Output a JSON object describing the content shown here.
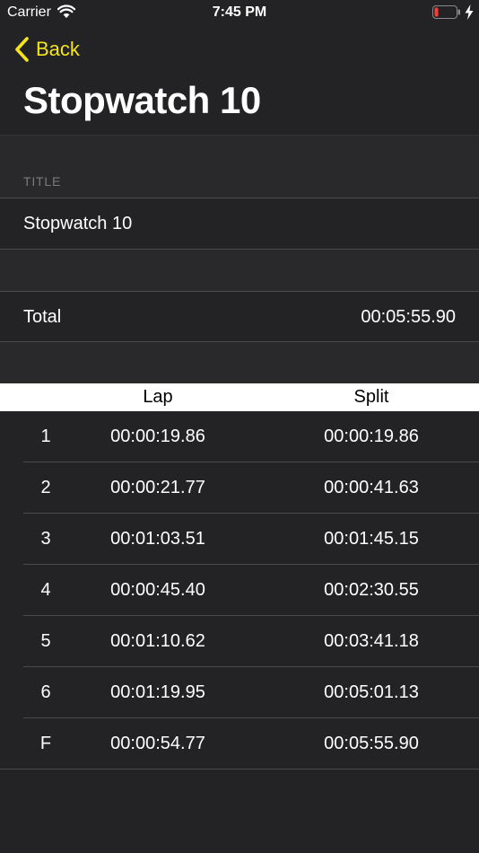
{
  "status_bar": {
    "carrier": "Carrier",
    "time": "7:45 PM",
    "battery_color": "#ff3b30"
  },
  "nav": {
    "back_label": "Back",
    "title": "Stopwatch 10",
    "accent_color": "#f4e41c"
  },
  "title_section": {
    "header": "TITLE",
    "value": "Stopwatch 10"
  },
  "total": {
    "label": "Total",
    "value": "00:05:55.90"
  },
  "laps": {
    "headers": {
      "lap": "Lap",
      "split": "Split"
    },
    "rows": [
      {
        "num": "1",
        "lap": "00:00:19.86",
        "split": "00:00:19.86"
      },
      {
        "num": "2",
        "lap": "00:00:21.77",
        "split": "00:00:41.63"
      },
      {
        "num": "3",
        "lap": "00:01:03.51",
        "split": "00:01:45.15"
      },
      {
        "num": "4",
        "lap": "00:00:45.40",
        "split": "00:02:30.55"
      },
      {
        "num": "5",
        "lap": "00:01:10.62",
        "split": "00:03:41.18"
      },
      {
        "num": "6",
        "lap": "00:01:19.95",
        "split": "00:05:01.13"
      },
      {
        "num": "F",
        "lap": "00:00:54.77",
        "split": "00:05:55.90"
      }
    ]
  }
}
